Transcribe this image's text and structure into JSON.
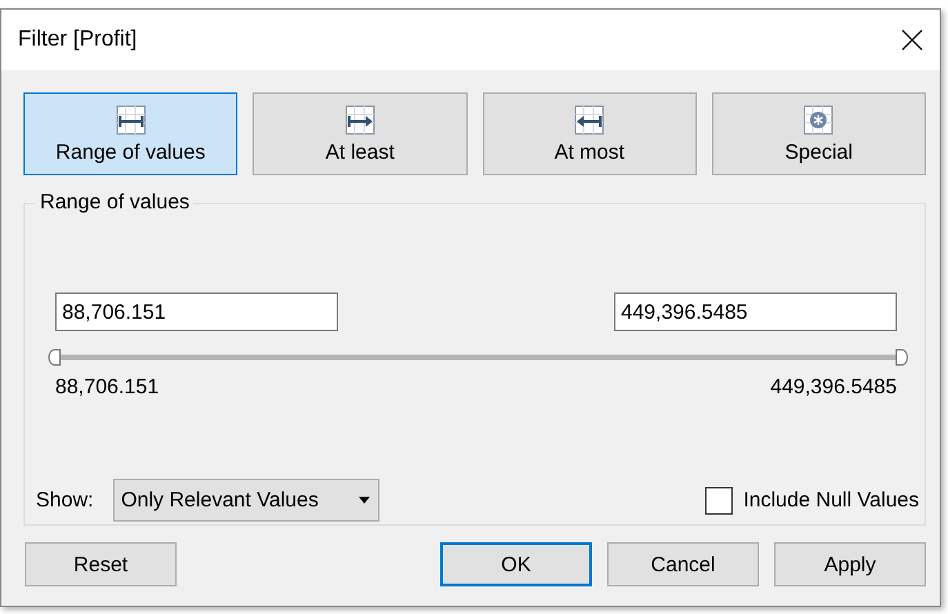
{
  "window": {
    "title": "Filter [Profit]"
  },
  "modes": [
    {
      "label": "Range of values",
      "kind": "range",
      "selected": true
    },
    {
      "label": "At least",
      "kind": "min",
      "selected": false
    },
    {
      "label": "At most",
      "kind": "max",
      "selected": false
    },
    {
      "label": "Special",
      "kind": "special",
      "selected": false
    }
  ],
  "group": {
    "title": "Range of values",
    "min_field": "88,706.151",
    "max_field": "449,396.5485",
    "min_label": "88,706.151",
    "max_label": "449,396.5485"
  },
  "slider": {
    "thumbs": [
      {
        "level": 0
      },
      {
        "level": 1
      }
    ]
  },
  "show": {
    "label": "Show:",
    "value": "Only Relevant Values"
  },
  "include_null": {
    "label": "Include Null Values",
    "checked": false
  },
  "buttons": [
    {
      "label": "Reset",
      "default": false
    },
    {
      "label": "OK",
      "default": true
    },
    {
      "label": "Cancel",
      "default": false
    },
    {
      "label": "Apply",
      "default": false
    }
  ]
}
